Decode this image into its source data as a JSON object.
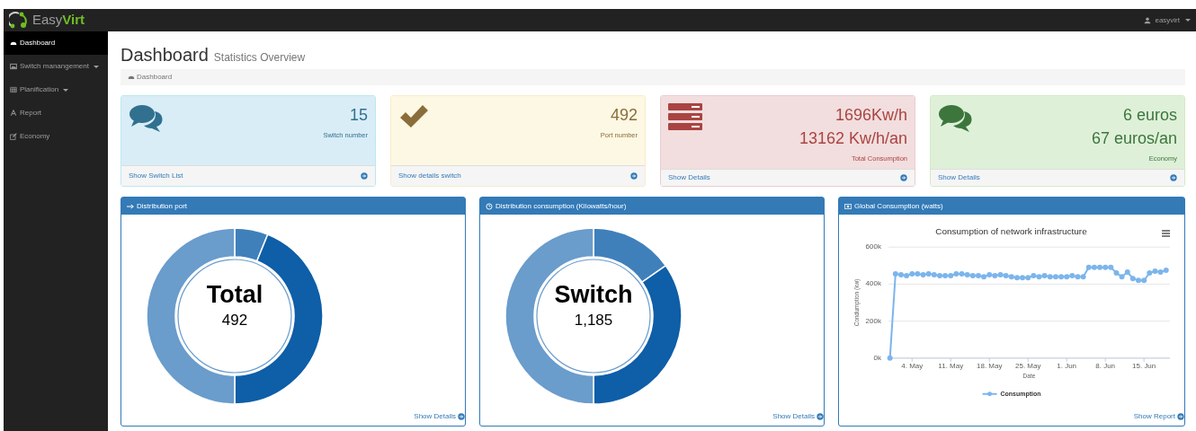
{
  "navbar": {
    "brand": {
      "text": "Easy",
      "accent": "Virt"
    },
    "user": {
      "label": "easyvirt",
      "dropdown": true
    }
  },
  "sidebar": {
    "items": [
      {
        "label": "Dashboard",
        "selected": true,
        "dropdown": false
      },
      {
        "label": "Switch manangement",
        "selected": false,
        "dropdown": true
      },
      {
        "label": "Planification ",
        "selected": false,
        "dropdown": true
      },
      {
        "label": "Report",
        "selected": false,
        "dropdown": false
      },
      {
        "label": "Economy",
        "selected": false,
        "dropdown": false
      }
    ]
  },
  "page": {
    "title": "Dashboard",
    "subtitle": "Statistics Overview",
    "breadcrumb": "Dashboard"
  },
  "stat_cards": [
    {
      "values": [
        "15"
      ],
      "label": "Switch number",
      "link": "Show Switch List"
    },
    {
      "values": [
        "492"
      ],
      "label": "Port number",
      "link": "Show details switch"
    },
    {
      "values": [
        "1696Kw/h",
        "13162 Kw/h/an"
      ],
      "label": "Total Consumption",
      "link": "Show Details"
    },
    {
      "values": [
        "6 euros",
        "67 euros/an"
      ],
      "label": "Economy",
      "link": "Show Details"
    }
  ],
  "panels": [
    {
      "kind": "donut",
      "title": "Distribution port",
      "center_title": "Total",
      "center_value": "492",
      "link": "Show Details"
    },
    {
      "kind": "donut",
      "title": "Distribution consumption (Kilowatts/hour)",
      "center_title": "Switch",
      "center_value": "1,185",
      "link": "Show Details"
    },
    {
      "kind": "line",
      "title": "Global Consumption (watts)",
      "link": "Show Report",
      "chart_data": {
        "type": "line",
        "title": "Consumption of network infrastructure",
        "xlabel": "Date",
        "ylabel": "Condumption (kw)",
        "categories": [
          null,
          null,
          null,
          null,
          "4. May",
          null,
          null,
          null,
          null,
          null,
          null,
          "11. May",
          null,
          null,
          null,
          null,
          null,
          null,
          "18. May",
          null,
          null,
          null,
          null,
          null,
          null,
          "25. May",
          null,
          null,
          null,
          null,
          null,
          null,
          "1. Jun",
          null,
          null,
          null,
          null,
          null,
          null,
          "8. Jun",
          null,
          null,
          null,
          null,
          null,
          null,
          "15. Jun",
          null,
          null,
          null,
          null
        ],
        "series": [
          {
            "name": "Consumption",
            "color": "#7cb5ec",
            "marker": true,
            "values": [
              0,
              455,
              450,
              445,
              455,
              455,
              450,
              455,
              450,
              445,
              445,
              445,
              455,
              455,
              450,
              445,
              445,
              440,
              450,
              445,
              450,
              445,
              440,
              435,
              435,
              435,
              445,
              440,
              445,
              440,
              440,
              440,
              440,
              445,
              440,
              440,
              490,
              490,
              490,
              490,
              490,
              460,
              440,
              465,
              430,
              420,
              420,
              460,
              470,
              465,
              475
            ]
          }
        ],
        "ylim": [
          0,
          600
        ],
        "yticks": [
          {
            "value": 0,
            "label": "0k"
          },
          {
            "value": 200,
            "label": "200k"
          },
          {
            "value": 400,
            "label": "400k"
          },
          {
            "value": 600,
            "label": "600k"
          }
        ]
      }
    }
  ]
}
